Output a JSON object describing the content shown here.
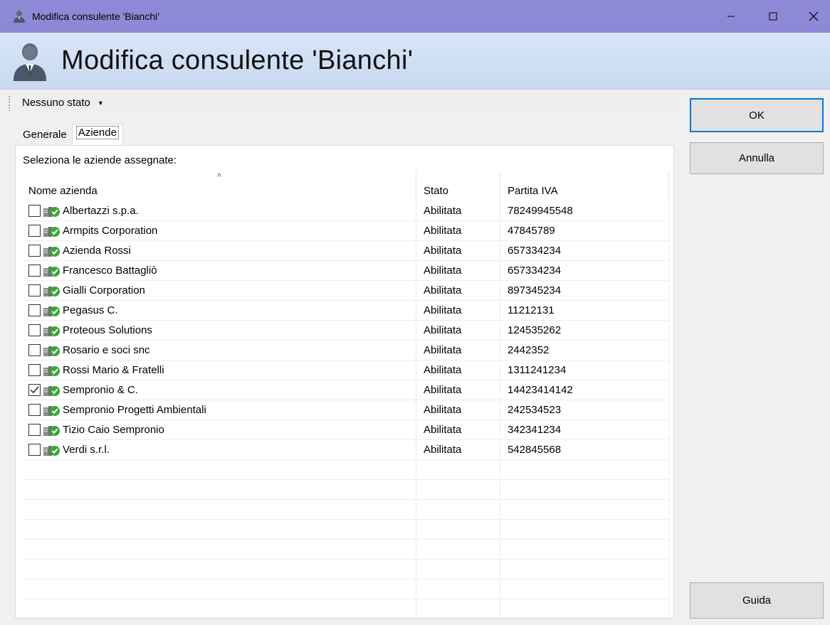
{
  "window": {
    "title": "Modifica consulente 'Bianchi'",
    "minimize_icon": "minimize-icon",
    "maximize_icon": "maximize-icon",
    "close_icon": "close-icon"
  },
  "header": {
    "title": "Modifica consulente 'Bianchi'",
    "icon": "consultant-icon"
  },
  "toolbar": {
    "status_label": "Nessuno stato"
  },
  "tabs": [
    {
      "label": "Generale",
      "active": false
    },
    {
      "label": "Aziende",
      "active": true
    }
  ],
  "panel": {
    "label": "Seleziona le aziende assegnate:"
  },
  "grid": {
    "columns": [
      "Nome azienda",
      "Stato",
      "Partita IVA"
    ],
    "sorted_column": "Nome azienda",
    "rows": [
      {
        "name": "Albertazzi s.p.a.",
        "stato": "Abilitata",
        "piva": "78249945548",
        "checked": false
      },
      {
        "name": "Armpits Corporation",
        "stato": "Abilitata",
        "piva": "47845789",
        "checked": false
      },
      {
        "name": "Azienda Rossi",
        "stato": "Abilitata",
        "piva": "657334234",
        "checked": false
      },
      {
        "name": "Francesco Battagliò",
        "stato": "Abilitata",
        "piva": "657334234",
        "checked": false
      },
      {
        "name": "Gialli Corporation",
        "stato": "Abilitata",
        "piva": "897345234",
        "checked": false
      },
      {
        "name": "Pegasus C.",
        "stato": "Abilitata",
        "piva": "11212131",
        "checked": false
      },
      {
        "name": "Proteous Solutions",
        "stato": "Abilitata",
        "piva": "124535262",
        "checked": false
      },
      {
        "name": "Rosario e soci snc",
        "stato": "Abilitata",
        "piva": "2442352",
        "checked": false
      },
      {
        "name": "Rossi Mario & Fratelli",
        "stato": "Abilitata",
        "piva": "1311241234",
        "checked": false
      },
      {
        "name": "Sempronio & C.",
        "stato": "Abilitata",
        "piva": "14423414142",
        "checked": true
      },
      {
        "name": "Sempronio Progetti Ambientali",
        "stato": "Abilitata",
        "piva": "242534523",
        "checked": false
      },
      {
        "name": "Tizio Caio Sempronio",
        "stato": "Abilitata",
        "piva": "342341234",
        "checked": false
      },
      {
        "name": "Verdi s.r.l.",
        "stato": "Abilitata",
        "piva": "542845568",
        "checked": false
      }
    ],
    "row_icon": "company-enabled-icon"
  },
  "buttons": {
    "ok": "OK",
    "cancel": "Annulla",
    "help": "Guida"
  },
  "colors": {
    "titlebar": "#8e89d6",
    "header_bg": "#d9e6f7",
    "ok_border": "#0078d7"
  }
}
